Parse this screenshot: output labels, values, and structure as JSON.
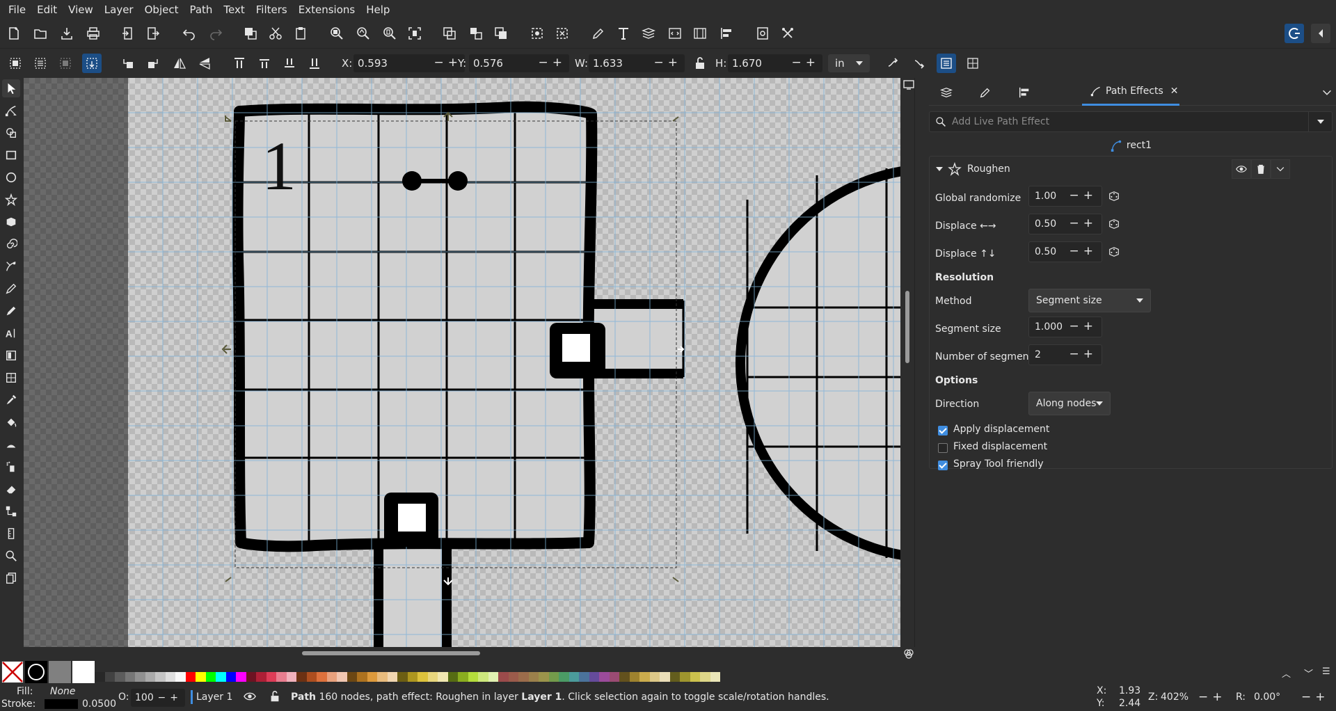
{
  "menu": [
    "File",
    "Edit",
    "View",
    "Layer",
    "Object",
    "Path",
    "Text",
    "Filters",
    "Extensions",
    "Help"
  ],
  "toolctrl": {
    "x_label": "X:",
    "x_value": "0.593",
    "y_label": "Y:",
    "y_value": "0.576",
    "w_label": "W:",
    "w_value": "1.633",
    "h_label": "H:",
    "h_value": "1.670",
    "unit": "in",
    "lock_icon": "lock-icon"
  },
  "dock": {
    "tab_label": "Path Effects",
    "search_placeholder": "Add Live Path Effect",
    "object_name": "rect1",
    "effect_name": "Roughen",
    "params": {
      "global_randomize_label": "Global randomize",
      "global_randomize_value": "1.00",
      "displace_x_label": "Displace ←→",
      "displace_x_value": "0.50",
      "displace_y_label": "Displace ↑↓",
      "displace_y_value": "0.50",
      "resolution_heading": "Resolution",
      "method_label": "Method",
      "method_value": "Segment size",
      "segment_size_label": "Segment size",
      "segment_size_value": "1.000",
      "num_segments_label": "Number of segments",
      "num_segments_value": "2",
      "options_heading": "Options",
      "direction_label": "Direction",
      "direction_value": "Along nodes",
      "apply_displacement_label": "Apply displacement",
      "apply_displacement": true,
      "fixed_displacement_label": "Fixed displacement",
      "fixed_displacement": false,
      "spray_friendly_label": "Spray Tool friendly",
      "spray_friendly": true
    }
  },
  "canvas": {
    "room_number": "1"
  },
  "status": {
    "fill_label": "Fill:",
    "fill_value": "None",
    "stroke_label": "Stroke:",
    "stroke_width": "0.0500",
    "opacity_label": "O:",
    "opacity_value": "100",
    "layer_name": "Layer 1",
    "message_bold": "Path",
    "message_1": " 160 nodes, path effect: Roughen in layer ",
    "message_layer": "Layer 1",
    "message_2": ". Click selection again to toggle scale/rotation handles.",
    "cursor_x_label": "X:",
    "cursor_x": "1.93",
    "cursor_y_label": "Y:",
    "cursor_y": "2.44",
    "zoom_label": "Z:",
    "zoom": "402%",
    "rotation_label": "R:",
    "rotation": "0.00°"
  },
  "colors": {
    "accent": "#3f8de0",
    "ui_bg": "#2d2d2d",
    "room_fill": "#d1d1d1",
    "wall": "#000000",
    "grid_guide": "#7fb3d9"
  }
}
